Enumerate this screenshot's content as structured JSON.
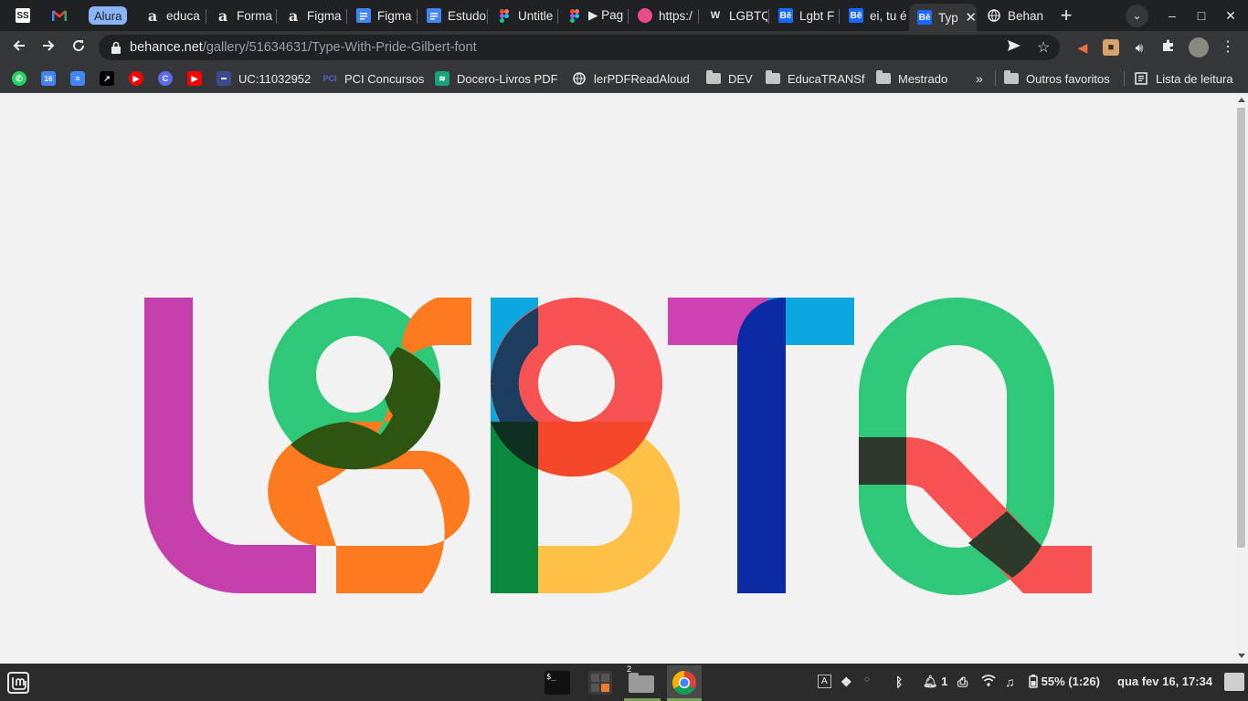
{
  "window": {
    "tabs": [
      {
        "label": "",
        "active": false
      },
      {
        "label": "",
        "active": false
      },
      {
        "label": "Alura",
        "group": true
      },
      {
        "label": "educa"
      },
      {
        "label": "Forma"
      },
      {
        "label": "Figma"
      },
      {
        "label": "Figma"
      },
      {
        "label": "Estudo"
      },
      {
        "label": "Untitle"
      },
      {
        "label": "▶ Pag"
      },
      {
        "label": "https:/"
      },
      {
        "label": "LGBTQ"
      },
      {
        "label": "Lgbt F"
      },
      {
        "label": "ei, tu é"
      },
      {
        "label": "Typ",
        "active": true
      },
      {
        "label": "Behan"
      }
    ],
    "new_tab": "+",
    "controls": {
      "minimize": "–",
      "maximize": "□",
      "close": "✕"
    }
  },
  "toolbar": {
    "url_host": "behance.net",
    "url_path": "/gallery/51634631/Type-With-Pride-Gilbert-font"
  },
  "bookmarks": {
    "items": [
      {
        "label": "UC:11032952"
      },
      {
        "label": "PCI Concursos"
      },
      {
        "label": "Docero-Livros PDF"
      },
      {
        "label": "lerPDFReadAloud"
      },
      {
        "label": "DEV"
      },
      {
        "label": "EducaTRANSf"
      },
      {
        "label": "Mestrado"
      }
    ],
    "overflow": "»",
    "other": "Outros favoritos",
    "reading_list": "Lista de leitura"
  },
  "content": {
    "artwork_word": "LGBTQ",
    "colors": {
      "magenta": "#d042b4",
      "green": "#2ec878",
      "orange": "#fd7a1e",
      "red": "#f75252",
      "blue": "#0aa7e0",
      "yellow": "#fec046",
      "navy": "#0c2aa4"
    }
  },
  "taskbar": {
    "workspace_badge": "2",
    "tray": {
      "keyboard": "A",
      "notifications": "1",
      "battery": "55% (1:26)",
      "clock": "qua fev 16, 17:34"
    }
  }
}
